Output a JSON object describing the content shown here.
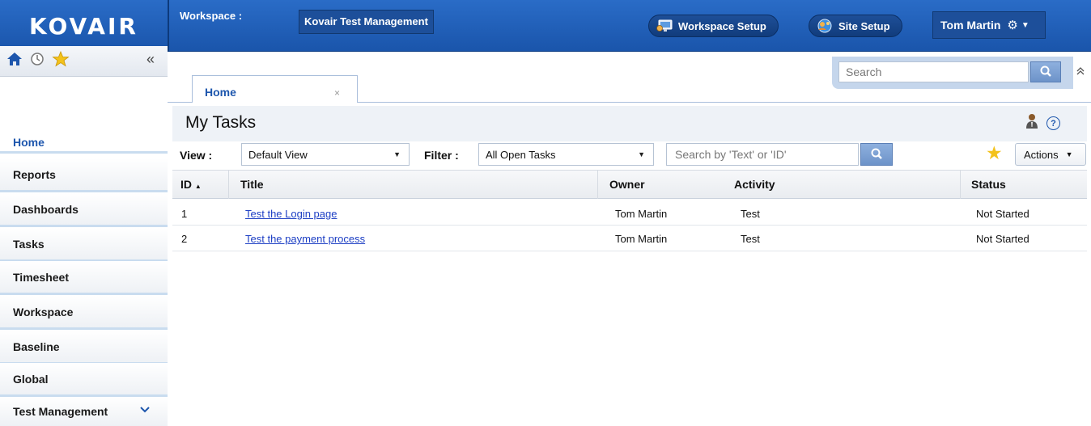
{
  "app": {
    "logo_text": "KOVAIR",
    "workspace_label": "Workspace :",
    "workspace_name": "Kovair Test Management",
    "workspace_setup": "Workspace Setup",
    "site_setup": "Site Setup",
    "user_name": "Tom Martin",
    "gear_glyph": "⚙",
    "caret_glyph": "▼"
  },
  "search": {
    "placeholder": "Search",
    "collapse_glyph": "»"
  },
  "tabs": [
    {
      "label": "Home",
      "close": "×"
    }
  ],
  "sidebar": {
    "collapse_glyph": "«",
    "items": [
      {
        "label": "Home"
      },
      {
        "label": "Reports"
      },
      {
        "label": "Dashboards"
      },
      {
        "label": "Tasks"
      },
      {
        "label": "Timesheet"
      },
      {
        "label": "Workspace"
      },
      {
        "label": "Baseline"
      },
      {
        "label": "Global"
      },
      {
        "label": "Test Management",
        "chevron": "⌵"
      }
    ]
  },
  "page": {
    "title": "My Tasks",
    "help_glyph": "?",
    "view_label": "View :",
    "view_value": "Default View",
    "filter_label": "Filter :",
    "filter_value": "All Open Tasks",
    "search_placeholder": "Search by 'Text' or 'ID'",
    "actions_label": "Actions",
    "dropdown_glyph": "▼",
    "star_glyph": "★"
  },
  "table": {
    "columns": [
      "ID",
      "Title",
      "Owner",
      "Activity",
      "Status"
    ],
    "sort_glyph": "▲",
    "rows": [
      {
        "id": "1",
        "title": "Test the Login page",
        "owner": "Tom Martin",
        "activity": "Test",
        "status": "Not Started"
      },
      {
        "id": "2",
        "title": "Test the payment process",
        "owner": "Tom Martin",
        "activity": "Test",
        "status": "Not Started"
      }
    ]
  },
  "colors": {
    "brand_blue": "#1d56ad",
    "star_yellow": "#f3c21b",
    "link_blue": "#1d3fc4"
  },
  "icons": [
    "home-icon",
    "history-icon",
    "favorites-star-icon",
    "search-icon",
    "person-icon",
    "help-icon",
    "monitor-icon",
    "site-icon",
    "gear-icon"
  ]
}
